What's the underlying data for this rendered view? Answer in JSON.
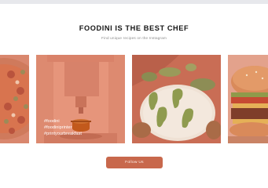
{
  "header": {
    "title": "FOODINI IS THE BEST CHEF",
    "subtitle": "Find unique recipes on the Instagram"
  },
  "gallery": {
    "overlay_color": "#e0886a",
    "posts": [
      {
        "subject": "pizza",
        "hashtags": []
      },
      {
        "subject": "foodini-3d-printer",
        "hashtags": [
          "#foodini",
          "#foodiniprinter",
          "#printyourbreakfast"
        ]
      },
      {
        "subject": "dinosaur-shaped-food",
        "hashtags": []
      },
      {
        "subject": "burger",
        "hashtags": []
      }
    ]
  },
  "cta": {
    "follow_label": "Follow Us",
    "color": "#c8684c"
  }
}
